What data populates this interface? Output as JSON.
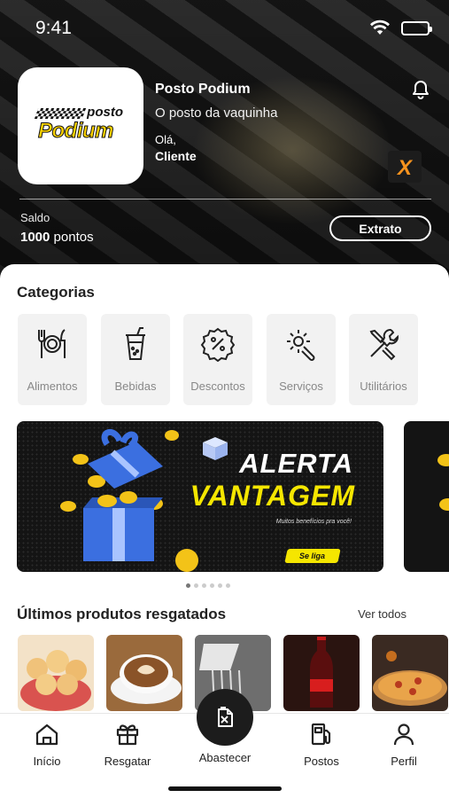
{
  "status_bar": {
    "time": "9:41"
  },
  "header": {
    "logo": {
      "top_word": "posto",
      "main_word": "Podium"
    },
    "station_name": "Posto Podium",
    "tagline": "O posto da vaquinha",
    "greeting": "Olá,",
    "user_name": "Cliente",
    "badge_letter": "X",
    "balance_label": "Saldo",
    "balance_amount": "1000",
    "balance_unit": "pontos",
    "extrato_button": "Extrato"
  },
  "categories": {
    "title": "Categorias",
    "items": [
      {
        "label": "Alimentos",
        "icon": "fork-plate-knife-icon"
      },
      {
        "label": "Bebidas",
        "icon": "drink-cup-icon"
      },
      {
        "label": "Descontos",
        "icon": "discount-badge-icon"
      },
      {
        "label": "Serviços",
        "icon": "gear-wrench-icon"
      },
      {
        "label": "Utilitários",
        "icon": "wrench-screwdriver-icon"
      }
    ]
  },
  "banner": {
    "line1": "ALERTA",
    "line2": "VANTAGEM",
    "subtitle": "Muitos benefícios pra você!",
    "cta": "Se liga",
    "colors": {
      "accent": "#f5e600",
      "background": "#141414"
    },
    "active_index": 0,
    "count": 6
  },
  "products": {
    "title": "Últimos produtos resgatados",
    "view_all": "Ver todos",
    "items": [
      {
        "name": "pão de queijo"
      },
      {
        "name": "café"
      },
      {
        "name": "lavagem"
      },
      {
        "name": "coca-cola"
      },
      {
        "name": "pizza"
      }
    ]
  },
  "bottom_nav": {
    "items": [
      {
        "label": "Início",
        "icon": "home-icon"
      },
      {
        "label": "Resgatar",
        "icon": "gift-icon"
      },
      {
        "label": "Abastecer",
        "icon": "fuel-can-icon"
      },
      {
        "label": "Postos",
        "icon": "fuel-pump-icon"
      },
      {
        "label": "Perfil",
        "icon": "user-icon"
      }
    ]
  }
}
